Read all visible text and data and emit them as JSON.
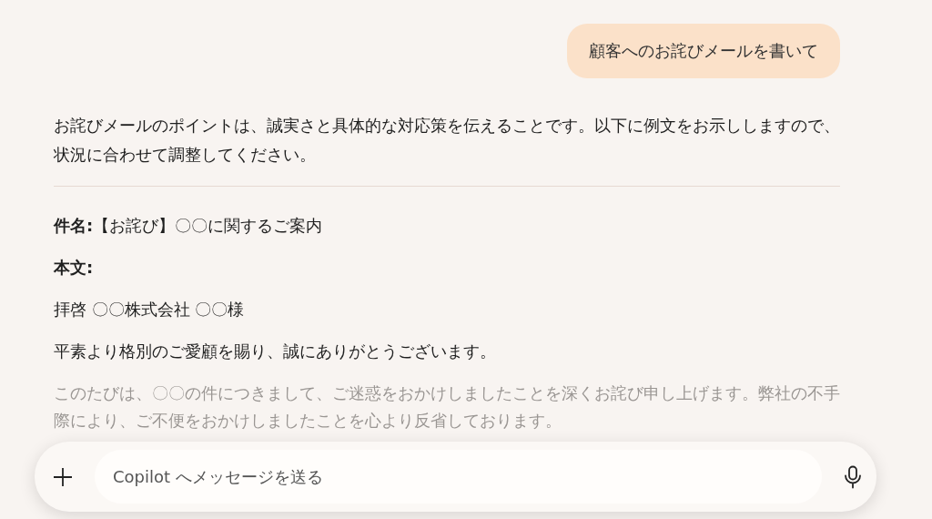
{
  "user_message": "顧客へのお詫びメールを書いて",
  "response": {
    "intro": "お詫びメールのポイントは、誠実さと具体的な対応策を伝えることです。以下に例文をお示ししますので、状況に合わせて調整してください。",
    "blocks": [
      {
        "kind": "field",
        "label": "件名:",
        "text": "【お詫び】〇〇に関するご案内"
      },
      {
        "kind": "label",
        "label": "本文:"
      },
      {
        "kind": "paragraph",
        "text": "拝啓 〇〇株式会社 〇〇様"
      },
      {
        "kind": "paragraph",
        "text": "平素より格別のご愛顧を賜り、誠にありがとうございます。"
      },
      {
        "kind": "fading",
        "text": "このたびは、〇〇の件につきまして、ご迷惑をおかけしましたことを深くお詫び申し上げます。弊社の不手際により、ご不便をおかけしましたことを心より反省しております。"
      }
    ]
  },
  "composer": {
    "placeholder": "Copilot へメッセージを送る"
  }
}
